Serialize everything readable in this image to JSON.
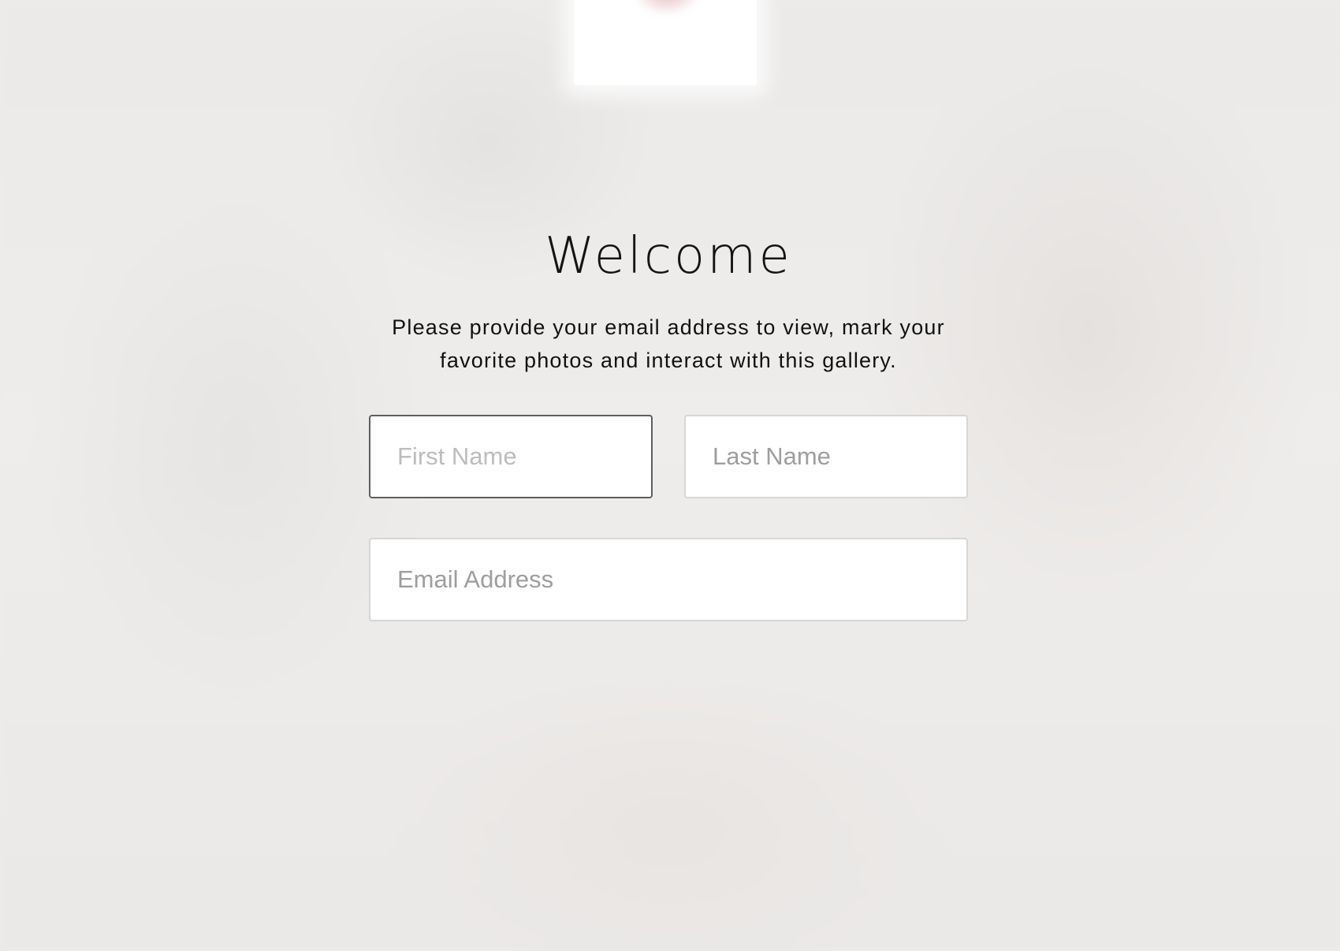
{
  "modal": {
    "title": "Welcome",
    "message": "Please provide your email address to view, mark your favorite photos and interact with this gallery."
  },
  "form": {
    "first_name": {
      "value": "",
      "placeholder": "First Name",
      "focused": true
    },
    "last_name": {
      "value": "",
      "placeholder": "Last Name"
    },
    "email": {
      "value": "",
      "placeholder": "Email Address"
    }
  }
}
